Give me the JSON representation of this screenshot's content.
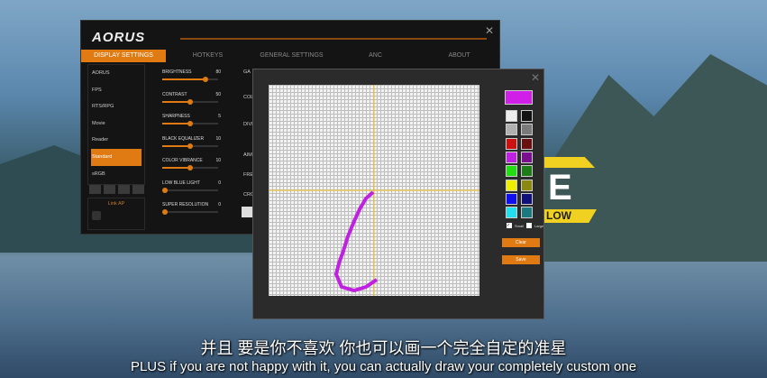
{
  "app": {
    "title": "AORUS",
    "tabs": [
      "DISPLAY SETTINGS",
      "HOTKEYS",
      "GENERAL SETTINGS",
      "ANC",
      "ABOUT"
    ],
    "modes": [
      "AORUS",
      "FPS",
      "RTS/RPG",
      "Movie",
      "Reader",
      "Standard",
      "sRGB"
    ],
    "active_mode": "Standard",
    "link_label": "Link AP",
    "sliders": [
      {
        "label": "BRIGHTNESS",
        "value": "80",
        "fraction": 0.8
      },
      {
        "label": "CONTRAST",
        "value": "50",
        "fraction": 0.5
      },
      {
        "label": "SHARPNESS",
        "value": "5",
        "fraction": 0.5
      },
      {
        "label": "BLACK EQUALIZER",
        "value": "10",
        "fraction": 0.5
      },
      {
        "label": "COLOR VIBRANCE",
        "value": "10",
        "fraction": 0.5
      },
      {
        "label": "LOW BLUE LIGHT",
        "value": "0",
        "fraction": 0
      },
      {
        "label": "SUPER RESOLUTION",
        "value": "0",
        "fraction": 0
      }
    ],
    "mid_labels": [
      "GA",
      "COL",
      "DIVI",
      "AIM",
      "FRE",
      "CRO"
    ]
  },
  "dialog": {
    "current_color": "#d020e8",
    "palette": [
      "#eeeeee",
      "#111111",
      "#b0b0b0",
      "#7a7a7a",
      "#cc1111",
      "#6a1010",
      "#c020e0",
      "#7a1090",
      "#22dd11",
      "#1f7a18",
      "#eeee00",
      "#8a8a10",
      "#1010ee",
      "#10107a",
      "#22ddee",
      "#1a7a80"
    ],
    "small_label": "Small",
    "large_label": "Large",
    "small_checked": true,
    "large_checked": false,
    "clear_label": "Clear",
    "save_label": "Save",
    "crosshair_color": "#f0c020",
    "stroke_color": "#c020e0"
  },
  "banner": {
    "letter": "E",
    "text": "LOW"
  },
  "subtitle": {
    "zh": "并且 要是你不喜欢 你也可以画一个完全自定的准星",
    "en": "PLUS if you are not happy with it, you can actually draw your completely custom one"
  }
}
